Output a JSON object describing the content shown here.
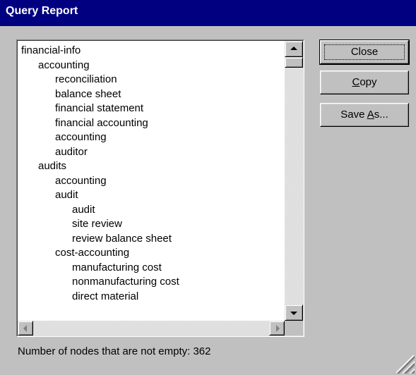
{
  "window": {
    "title": "Query Report"
  },
  "tree": [
    {
      "label": "financial-info",
      "level": 0
    },
    {
      "label": "accounting",
      "level": 1
    },
    {
      "label": "reconciliation",
      "level": 2
    },
    {
      "label": "balance sheet",
      "level": 2
    },
    {
      "label": "financial statement",
      "level": 2
    },
    {
      "label": "financial accounting",
      "level": 2
    },
    {
      "label": "accounting",
      "level": 2
    },
    {
      "label": "auditor",
      "level": 2
    },
    {
      "label": "audits",
      "level": 1
    },
    {
      "label": "accounting",
      "level": 2
    },
    {
      "label": "audit",
      "level": 2
    },
    {
      "label": "audit",
      "level": 3
    },
    {
      "label": "site review",
      "level": 3
    },
    {
      "label": "review balance sheet",
      "level": 3
    },
    {
      "label": "cost-accounting",
      "level": 2
    },
    {
      "label": "manufacturing cost",
      "level": 3
    },
    {
      "label": "nonmanufacturing cost",
      "level": 3
    },
    {
      "label": "direct material",
      "level": 3
    }
  ],
  "buttons": {
    "close": "Close",
    "copy_mnemonic": "C",
    "copy_rest": "opy",
    "save_prefix": "Save ",
    "save_mnemonic": "A",
    "save_suffix": "s..."
  },
  "status": {
    "text": "Number of nodes that are not empty: 362"
  },
  "icons": {
    "scroll_up": "arrow-up-icon",
    "scroll_down": "arrow-down-icon",
    "scroll_left": "arrow-left-icon",
    "scroll_right": "arrow-right-icon",
    "resize_grip": "resize-grip-icon"
  }
}
